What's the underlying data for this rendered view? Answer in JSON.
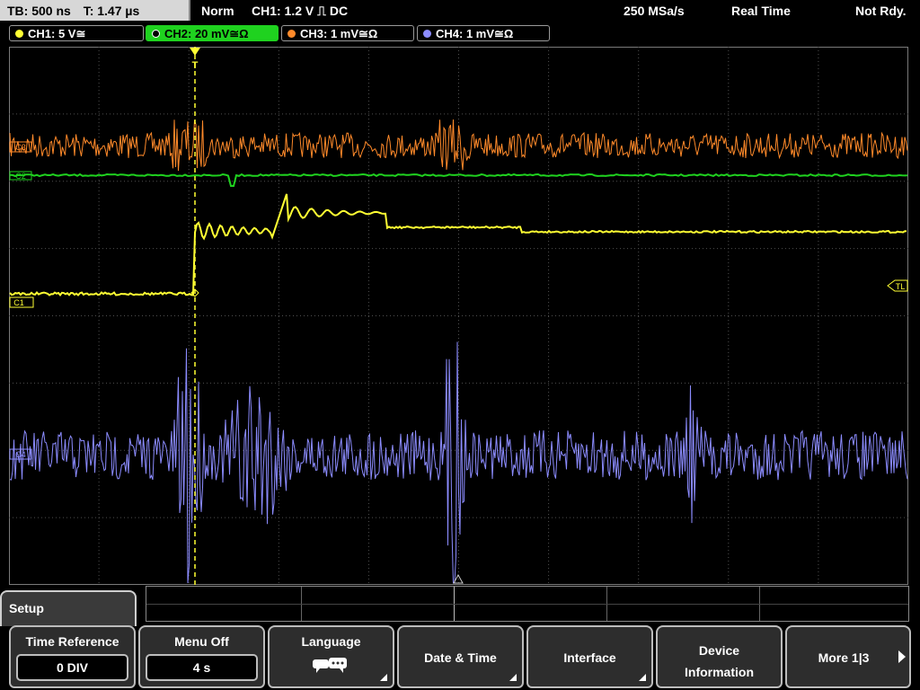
{
  "header": {
    "timebase": "TB: 500 ns",
    "trigger_time": "T: 1.47 µs",
    "mode": "Norm",
    "trigger_info": "CH1: 1.2 V ⎍ DC",
    "sample_rate": "250 MSa/s",
    "acq_mode": "Real Time",
    "status": "Not Rdy."
  },
  "channels": [
    {
      "label": "CH1: 5 V≅",
      "color": "#ffff33"
    },
    {
      "label": "CH2: 20 mV≅Ω",
      "color": "#1fd21f"
    },
    {
      "label": "CH3: 1 mV≅Ω",
      "color": "#ff8a2a"
    },
    {
      "label": "CH4: 1 mV≅Ω",
      "color": "#8c8cff"
    }
  ],
  "markers": {
    "c1": "C1",
    "c2": "C2",
    "c3": "C3",
    "c4": "C4",
    "trigger_level": "TL",
    "trigger_pos": "T"
  },
  "menu": {
    "title": "Setup",
    "time_reference": {
      "label": "Time Reference",
      "value": "0 DIV"
    },
    "menu_off": {
      "label": "Menu Off",
      "value": "4 s"
    },
    "language": {
      "label": "Language"
    },
    "date_time": {
      "label": "Date & Time"
    },
    "interface": {
      "label": "Interface"
    },
    "device_info": {
      "line1": "Device",
      "line2": "Information"
    },
    "more": {
      "label": "More 1|3"
    }
  },
  "colors": {
    "ch1": "#ffff33",
    "ch2": "#1fd21f",
    "ch3": "#ff8a2a",
    "ch4": "#8c8cff",
    "grid": "#5a5a5a"
  }
}
